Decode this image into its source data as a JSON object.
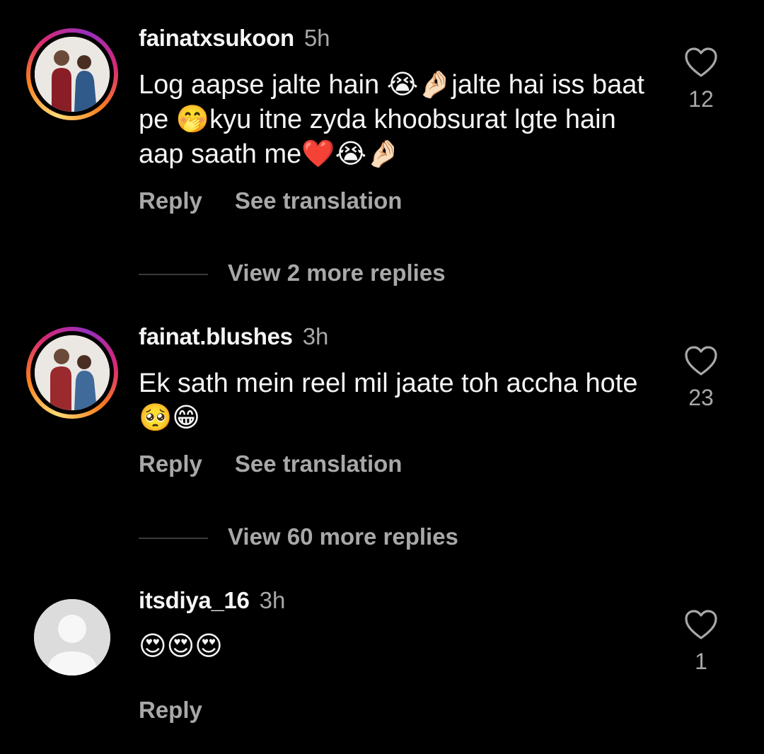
{
  "comments": [
    {
      "username": "fainatxsukoon",
      "time": "5h",
      "text": "Log aapse jalte hain 😭🤌🏻jalte hai iss baat pe 🤭kyu itne zyda khoobsurat lgte hain aap saath me❤️😭🤌🏻",
      "reply_label": "Reply",
      "translate_label": "See translation",
      "likes": "12",
      "view_replies": "View 2 more replies",
      "avatar": "profile-photo-couple"
    },
    {
      "username": "fainat.blushes",
      "time": "3h",
      "text": "Ek sath mein reel mil jaate toh accha hote 🥺😁",
      "reply_label": "Reply",
      "translate_label": "See translation",
      "likes": "23",
      "view_replies": "View 60 more replies",
      "avatar": "profile-photo-couple"
    },
    {
      "username": "itsdiya_16",
      "time": "3h",
      "text": "😍😍😍",
      "reply_label": "Reply",
      "likes": "1",
      "avatar": "default-avatar"
    }
  ],
  "icons": {
    "like": "heart-outline-icon"
  },
  "colors": {
    "background": "#000000",
    "primary_text": "#f5f5f5",
    "secondary_text": "#a8a8a8",
    "story_ring": [
      "#feda75",
      "#fa7e1e",
      "#d62976",
      "#962fbf"
    ]
  }
}
